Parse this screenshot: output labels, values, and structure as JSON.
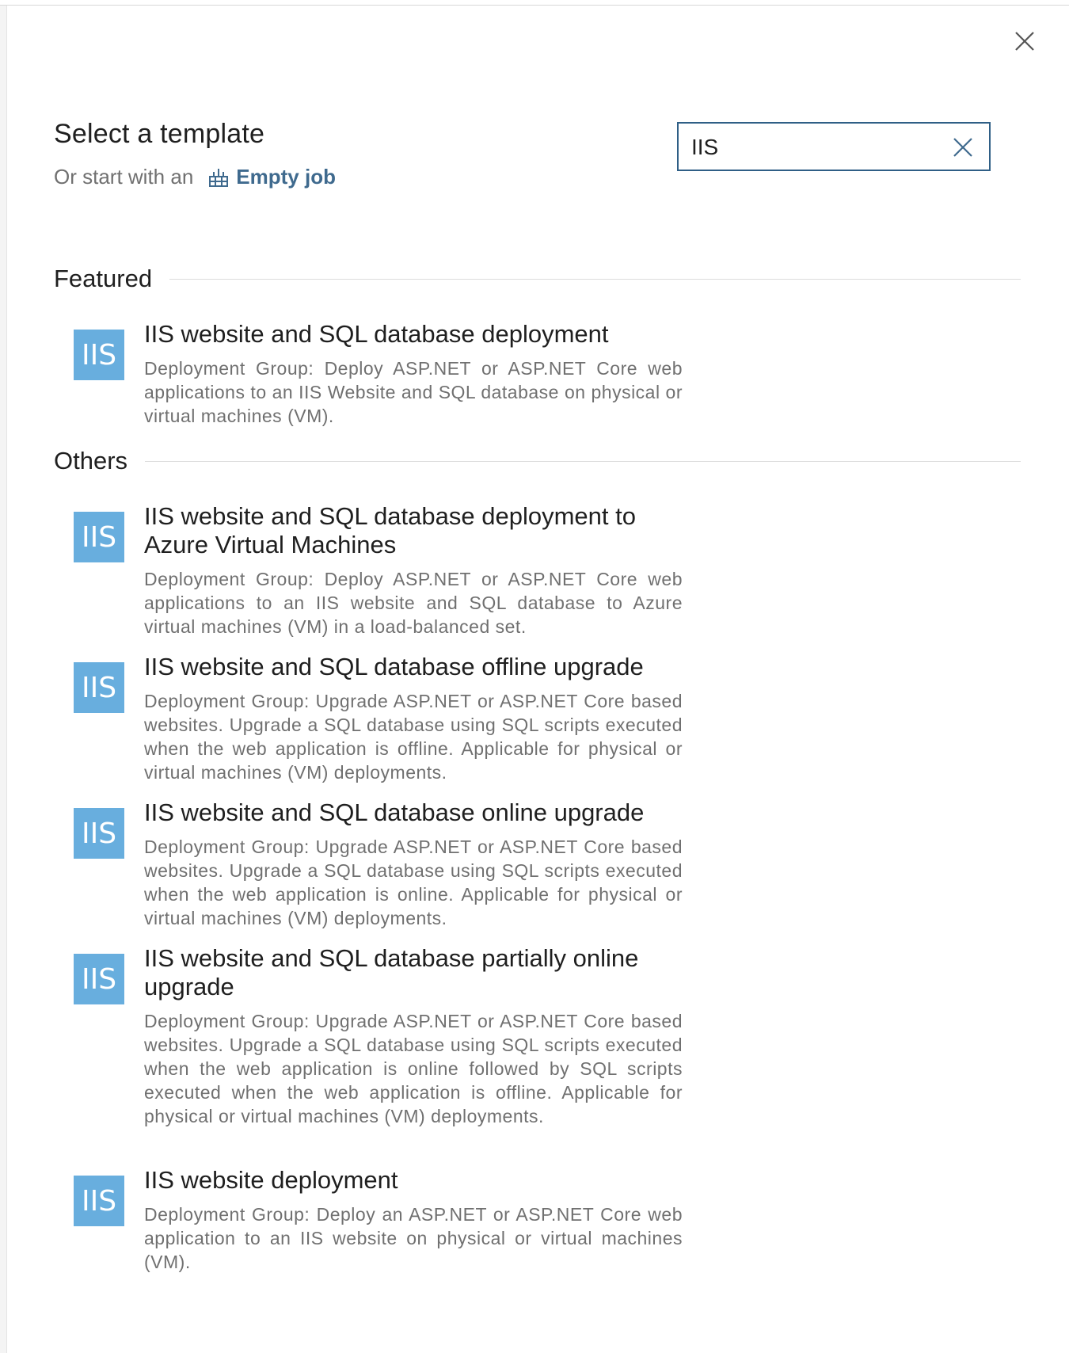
{
  "dialog": {
    "title": "Select a template",
    "subtitle_prefix": "Or start with an",
    "empty_job_label": "Empty job"
  },
  "search": {
    "value": "IIS",
    "placeholder": ""
  },
  "sections": {
    "featured": {
      "heading": "Featured",
      "items": [
        {
          "icon_text": "IIS",
          "title": "IIS website and SQL database deployment",
          "description": "Deployment Group: Deploy ASP.NET or ASP.NET Core web applications to an IIS Website and SQL database on physical or virtual machines (VM)."
        }
      ]
    },
    "others": {
      "heading": "Others",
      "items": [
        {
          "icon_text": "IIS",
          "title": "IIS website and SQL database deployment to Azure Virtual Machines",
          "description": "Deployment Group: Deploy ASP.NET or ASP.NET Core web applications to an IIS website and SQL database to Azure virtual machines (VM) in a load-balanced set."
        },
        {
          "icon_text": "IIS",
          "title": "IIS website and SQL database offline upgrade",
          "description": "Deployment Group: Upgrade ASP.NET or ASP.NET Core based websites. Upgrade a SQL database using SQL scripts executed when the web application is offline. Applicable for physical or virtual machines (VM) deployments."
        },
        {
          "icon_text": "IIS",
          "title": "IIS website and SQL database online upgrade",
          "description": "Deployment Group: Upgrade ASP.NET or ASP.NET Core based websites. Upgrade a SQL database using SQL scripts executed when the web application is online. Applicable for physical or virtual machines (VM) deployments."
        },
        {
          "icon_text": "IIS",
          "title": "IIS website and SQL database partially online upgrade",
          "description": "Deployment Group: Upgrade ASP.NET or ASP.NET Core based websites. Upgrade a SQL database using SQL scripts executed when the web application is online followed by SQL scripts executed when the web application is offline. Applicable for physical or virtual machines (VM) deployments."
        },
        {
          "icon_text": "IIS",
          "title": "IIS website deployment",
          "description": "Deployment Group: Deploy an ASP.NET or ASP.NET Core web application to an IIS website on physical or virtual machines (VM)."
        }
      ]
    }
  },
  "colors": {
    "accent": "#3f6a8e",
    "search_border": "#2f5f86",
    "iis_tile": "#68aede"
  },
  "icons": {
    "close": "close-icon",
    "clear_search": "clear-search-icon",
    "empty_job": "empty-job-icon",
    "template": "iis-icon"
  }
}
